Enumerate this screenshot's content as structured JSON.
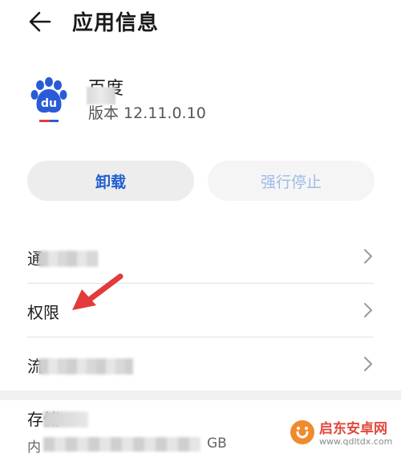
{
  "header": {
    "title": "应用信息"
  },
  "app": {
    "name": "百度",
    "version_label": "版本 12.11.0.10"
  },
  "actions": {
    "uninstall_label": "卸载",
    "force_stop_label": "强行停止"
  },
  "settings": {
    "items": [
      {
        "label": "通",
        "redacted": true
      },
      {
        "label": "权限",
        "redacted": false
      },
      {
        "label": "流",
        "redacted": true
      }
    ]
  },
  "storage": {
    "title": "存储",
    "subtitle_prefix": "内",
    "subtitle_unit": "GB"
  },
  "watermark": {
    "name": "启东安卓网",
    "url": "www.qdltdx.com"
  },
  "colors": {
    "accent_blue": "#1f5fcf",
    "disabled_blue": "#9dbbe6",
    "annotation_red": "#e23b3b",
    "button_bg": "#ededed"
  },
  "icons": {
    "back": "arrow-left-icon",
    "chevron": "chevron-right-icon",
    "app_logo": "baidu-paw-icon",
    "annotation": "red-arrow-icon"
  }
}
